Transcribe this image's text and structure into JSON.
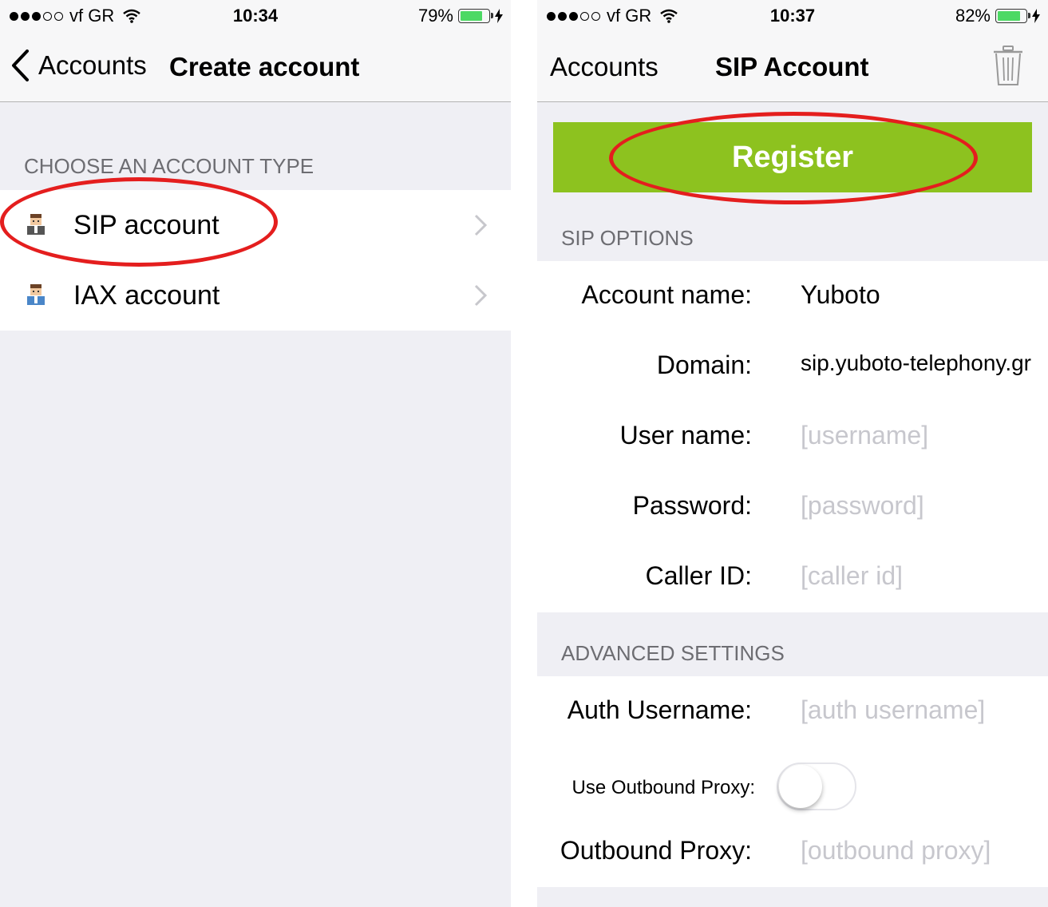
{
  "colors": {
    "accent_green": "#8dc21f",
    "battery_green": "#4cd964",
    "highlight_red": "#e41e1e",
    "section_gray": "#6d6d72",
    "placeholder_gray": "#c7c7cd"
  },
  "left": {
    "status": {
      "carrier": "vf GR",
      "time": "10:34",
      "battery": "79%",
      "battery_level": 0.79
    },
    "nav": {
      "back_label": "Accounts",
      "title": "Create account"
    },
    "section_header": "CHOOSE AN ACCOUNT TYPE",
    "items": [
      {
        "label": "SIP account",
        "icon": "user-avatar-icon"
      },
      {
        "label": "IAX account",
        "icon": "user-avatar-icon"
      }
    ]
  },
  "right": {
    "status": {
      "carrier": "vf GR",
      "time": "10:37",
      "battery": "82%",
      "battery_level": 0.82
    },
    "nav": {
      "left_label": "Accounts",
      "title": "SIP Account",
      "right_icon": "trash-icon"
    },
    "register_label": "Register",
    "sip_options": {
      "header": "SIP OPTIONS",
      "account_name": {
        "label": "Account name:",
        "value": "Yuboto"
      },
      "domain": {
        "label": "Domain:",
        "value": "sip.yuboto-telephony.gr"
      },
      "user_name": {
        "label": "User name:",
        "placeholder": "[username]"
      },
      "password": {
        "label": "Password:",
        "placeholder": "[password]"
      },
      "caller_id": {
        "label": "Caller ID:",
        "placeholder": "[caller id]"
      }
    },
    "advanced": {
      "header": "ADVANCED SETTINGS",
      "auth_username": {
        "label": "Auth Username:",
        "placeholder": "[auth username]"
      },
      "use_outbound_proxy": {
        "label": "Use Outbound Proxy:",
        "on": false
      },
      "outbound_proxy": {
        "label": "Outbound Proxy:",
        "placeholder": "[outbound proxy]"
      }
    }
  }
}
